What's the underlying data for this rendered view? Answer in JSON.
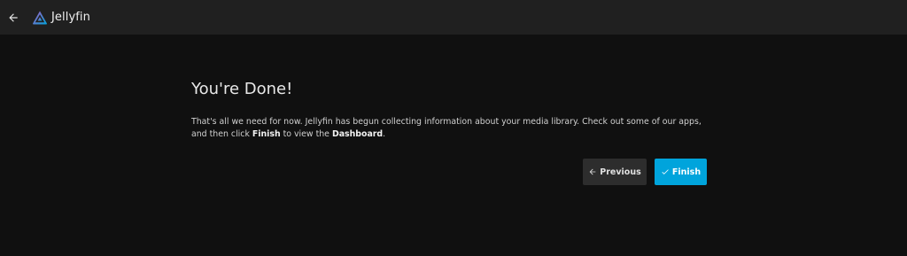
{
  "header": {
    "app_name": "Jellyfin",
    "back_icon": "arrow-left-icon",
    "logo_icon": "jellyfin-logo-icon"
  },
  "wizard": {
    "title": "You're Done!",
    "desc_part1": "That's all we need for now. Jellyfin has begun collecting information about your media library. Check out some of our apps, and then click ",
    "desc_bold1": "Finish",
    "desc_part2": " to view the ",
    "desc_bold2": "Dashboard",
    "desc_part3": "."
  },
  "buttons": {
    "previous_label": "Previous",
    "previous_icon": "arrow-left-icon",
    "finish_label": "Finish",
    "finish_icon": "check-icon"
  },
  "colors": {
    "background": "#101010",
    "header": "#202020",
    "accent": "#00a4dc",
    "button_secondary": "#2d2d2d"
  }
}
